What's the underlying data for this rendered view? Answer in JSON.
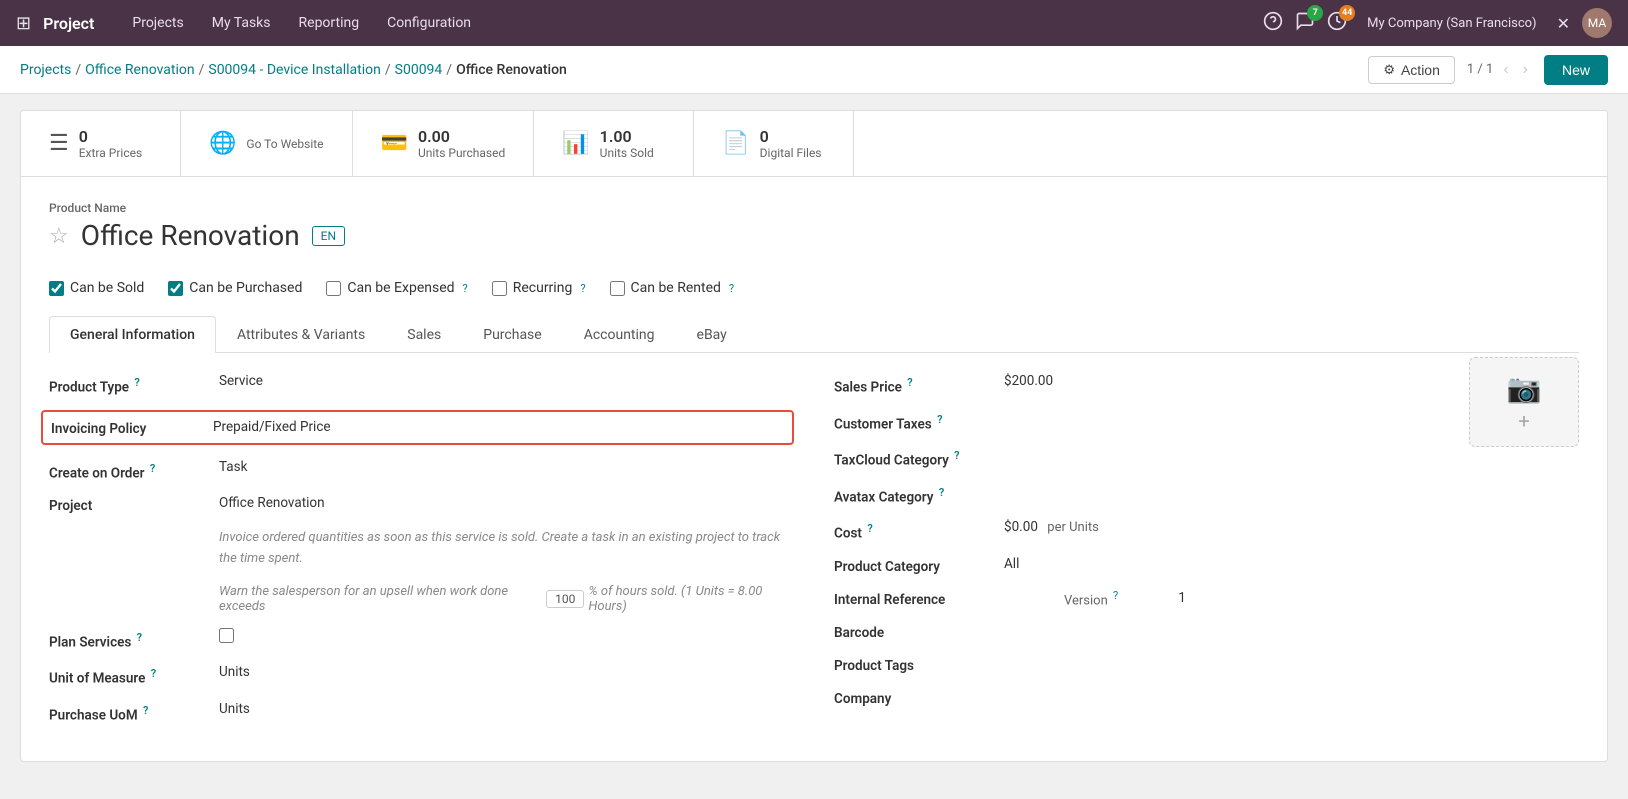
{
  "app": {
    "name": "Project",
    "nav_items": [
      "Projects",
      "My Tasks",
      "Reporting",
      "Configuration"
    ]
  },
  "topbar": {
    "badges": {
      "chat": "7",
      "activity": "44"
    },
    "company": "My Company (San Francisco)",
    "user": "Mitchell Admin"
  },
  "breadcrumb": {
    "items": [
      "Projects",
      "Office Renovation",
      "S00094 - Device Installation",
      "S00094",
      "Office Renovation"
    ],
    "links": [
      true,
      true,
      true,
      true,
      false
    ]
  },
  "toolbar": {
    "action_label": "Action",
    "pagination": "1 / 1",
    "new_label": "New"
  },
  "stats": [
    {
      "icon": "≡",
      "number": "0",
      "label": "Extra Prices"
    },
    {
      "icon": "🌐",
      "number": "",
      "label": "Go To Website"
    },
    {
      "icon": "💳",
      "number": "0.00",
      "label": "Units Purchased"
    },
    {
      "icon": "📊",
      "number": "1.00",
      "label": "Units Sold"
    },
    {
      "icon": "📄",
      "number": "0",
      "label": "Digital Files"
    }
  ],
  "product": {
    "name_label": "Product Name",
    "name": "Office Renovation",
    "lang": "EN",
    "checkboxes": [
      {
        "id": "can_sold",
        "label": "Can be Sold",
        "checked": true
      },
      {
        "id": "can_purchased",
        "label": "Can be Purchased",
        "checked": true
      },
      {
        "id": "can_expensed",
        "label": "Can be Expensed",
        "checked": false,
        "has_help": true
      },
      {
        "id": "recurring",
        "label": "Recurring",
        "checked": false,
        "has_help": true
      },
      {
        "id": "can_rented",
        "label": "Can be Rented",
        "checked": false,
        "has_help": true
      }
    ]
  },
  "tabs": [
    {
      "id": "general",
      "label": "General Information",
      "active": true
    },
    {
      "id": "attributes",
      "label": "Attributes & Variants",
      "active": false
    },
    {
      "id": "sales",
      "label": "Sales",
      "active": false
    },
    {
      "id": "purchase",
      "label": "Purchase",
      "active": false
    },
    {
      "id": "accounting",
      "label": "Accounting",
      "active": false
    },
    {
      "id": "ebay",
      "label": "eBay",
      "active": false
    }
  ],
  "general_info": {
    "left": [
      {
        "label": "Product Type",
        "value": "Service",
        "help": true
      },
      {
        "label": "Invoicing Policy",
        "value": "Prepaid/Fixed Price",
        "help": false,
        "highlight": true
      },
      {
        "label": "Create on Order",
        "value": "Task",
        "help": true
      },
      {
        "label": "Project",
        "value": "Office Renovation",
        "help": false
      }
    ],
    "description": "Invoice ordered quantities as soon as this service is sold. Create a task in an existing project to track the time spent.",
    "warn_text": "Warn the salesperson for an upsell when work done exceeds",
    "warn_percent": "100",
    "warn_unit_text": "% of hours sold. (1 Units = 8.00 Hours)",
    "plan_services_label": "Plan Services",
    "plan_services_help": true,
    "unit_of_measure_label": "Unit of Measure",
    "unit_of_measure_value": "Units",
    "unit_of_measure_help": true,
    "purchase_uom_label": "Purchase UoM",
    "purchase_uom_value": "Units",
    "purchase_uom_help": true,
    "right": [
      {
        "label": "Sales Price",
        "value": "$200.00",
        "help": true
      },
      {
        "label": "Customer Taxes",
        "value": "",
        "help": true
      },
      {
        "label": "TaxCloud Category",
        "value": "",
        "help": true
      },
      {
        "label": "Avatax Category",
        "value": "",
        "help": true
      },
      {
        "label": "Cost",
        "value": "$0.00",
        "help": true,
        "extra": "per Units"
      },
      {
        "label": "Product Category",
        "value": "All",
        "help": false
      },
      {
        "label": "Internal Reference",
        "value": "",
        "help": false,
        "version_label": "Version",
        "version_value": "1",
        "version_help": true
      },
      {
        "label": "Barcode",
        "value": "",
        "help": false
      },
      {
        "label": "Product Tags",
        "value": "",
        "help": false
      },
      {
        "label": "Company",
        "value": "",
        "help": false
      }
    ]
  }
}
